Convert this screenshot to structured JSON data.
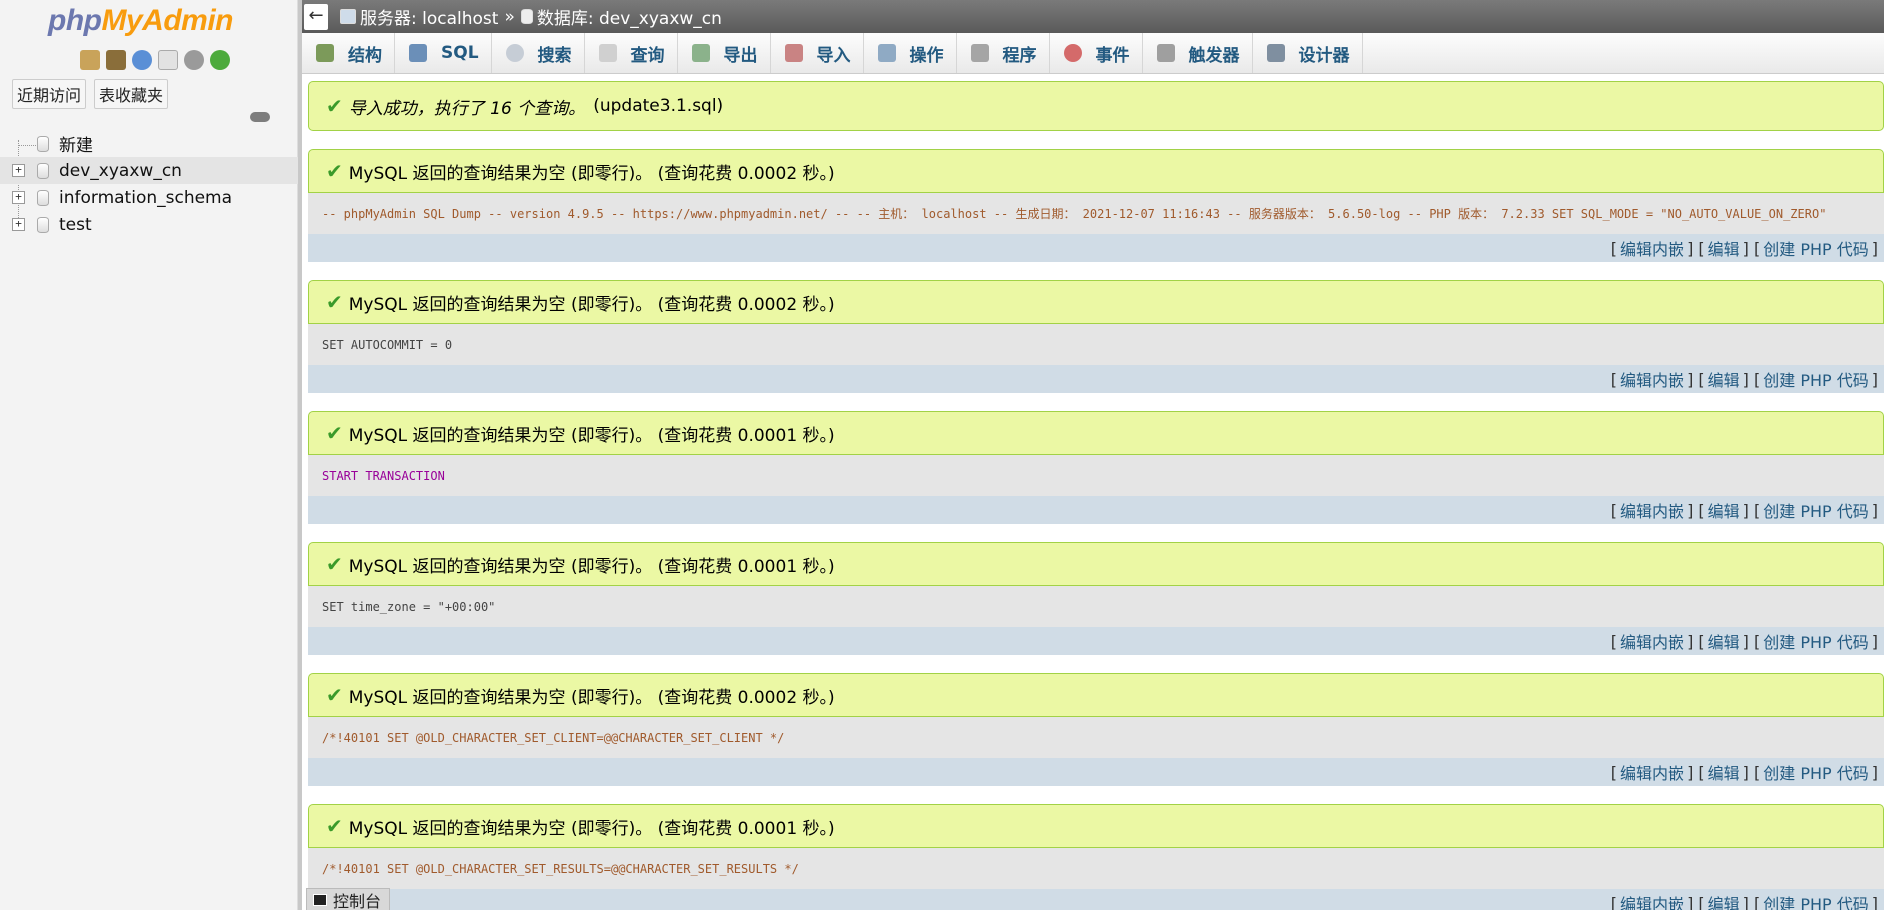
{
  "sidebar": {
    "logo_php": "php",
    "logo_myadmin": "MyAdmin",
    "icons": [
      "home-icon",
      "exit-icon",
      "help-icon",
      "docs-icon",
      "settings-icon",
      "reload-icon"
    ],
    "tabs": [
      "近期访问",
      "表收藏夹"
    ],
    "tree": [
      {
        "label": "新建",
        "new": true
      },
      {
        "label": "dev_xyaxw_cn",
        "selected": true
      },
      {
        "label": "information_schema"
      },
      {
        "label": "test"
      }
    ]
  },
  "breadcrumb": {
    "server_label": "服务器: localhost",
    "separator": "»",
    "db_label": "数据库: dev_xyaxw_cn"
  },
  "tabs": [
    {
      "label": "结构",
      "icon": "structure-icon"
    },
    {
      "label": "SQL",
      "icon": "sql-icon"
    },
    {
      "label": "搜索",
      "icon": "search-icon"
    },
    {
      "label": "查询",
      "icon": "query-icon"
    },
    {
      "label": "导出",
      "icon": "export-icon"
    },
    {
      "label": "导入",
      "icon": "import-icon"
    },
    {
      "label": "操作",
      "icon": "operations-icon"
    },
    {
      "label": "程序",
      "icon": "routines-icon"
    },
    {
      "label": "事件",
      "icon": "events-icon"
    },
    {
      "label": "触发器",
      "icon": "triggers-icon"
    },
    {
      "label": "设计器",
      "icon": "designer-icon"
    }
  ],
  "import_message": {
    "text": "导入成功，执行了 16 个查询。",
    "file": "(update3.1.sql)"
  },
  "results": [
    {
      "message": "MySQL 返回的查询结果为空 (即零行)。 (查询花费 0.0002 秒。)",
      "sql": "-- phpMyAdmin SQL Dump -- version 4.9.5 -- https://www.phpmyadmin.net/ -- -- 主机： localhost -- 生成日期： 2021-12-07 11:16:43 -- 服务器版本： 5.6.50-log -- PHP 版本： 7.2.33 SET SQL_MODE = \"NO_AUTO_VALUE_ON_ZERO\""
    },
    {
      "message": "MySQL 返回的查询结果为空 (即零行)。 (查询花费 0.0002 秒。)",
      "sql": "SET AUTOCOMMIT = 0"
    },
    {
      "message": "MySQL 返回的查询结果为空 (即零行)。 (查询花费 0.0001 秒。)",
      "sql": "START TRANSACTION"
    },
    {
      "message": "MySQL 返回的查询结果为空 (即零行)。 (查询花费 0.0001 秒。)",
      "sql": "SET time_zone = \"+00:00\""
    },
    {
      "message": "MySQL 返回的查询结果为空 (即零行)。 (查询花费 0.0002 秒。)",
      "sql": "/*!40101 SET @OLD_CHARACTER_SET_CLIENT=@@CHARACTER_SET_CLIENT */"
    },
    {
      "message": "MySQL 返回的查询结果为空 (即零行)。 (查询花费 0.0001 秒。)",
      "sql": "/*!40101 SET @OLD_CHARACTER_SET_RESULTS=@@CHARACTER_SET_RESULTS */"
    }
  ],
  "actions": {
    "edit_inline": "编辑内嵌",
    "edit": "编辑",
    "create_php": "创建 PHP 代码"
  },
  "console": {
    "label": "控制台"
  },
  "colors": {
    "success_bg": "#ebf8a4",
    "success_border": "#a2d246",
    "link": "#235a81",
    "topbar": "#666666"
  }
}
